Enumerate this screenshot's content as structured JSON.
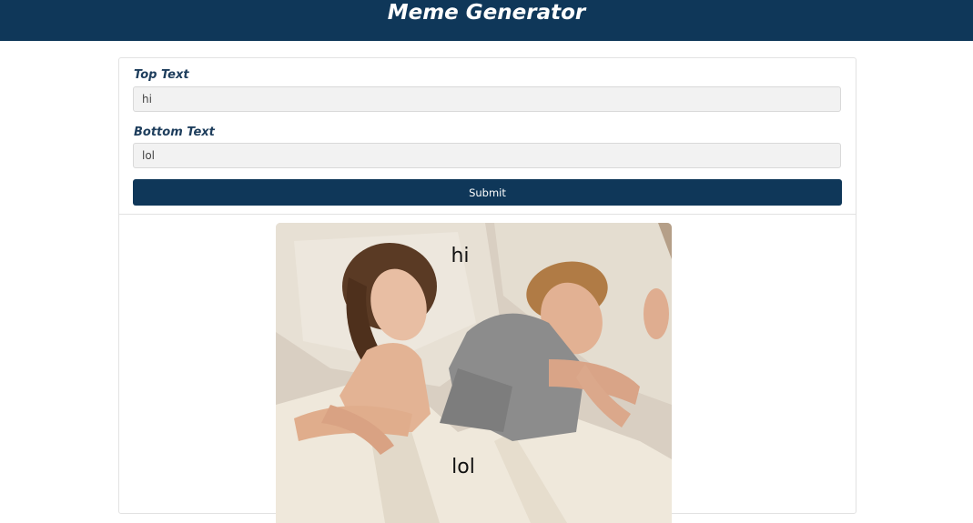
{
  "header": {
    "title": "Meme Generator"
  },
  "form": {
    "top_label": "Top Text",
    "top_value": "hi",
    "bottom_label": "Bottom Text",
    "bottom_value": "lol",
    "submit_label": "Submit"
  },
  "meme": {
    "top_text": "hi",
    "bottom_text": "lol"
  },
  "colors": {
    "header_bg": "#0f3759",
    "button_bg": "#0f3759",
    "label_color": "#1d3d5c"
  }
}
